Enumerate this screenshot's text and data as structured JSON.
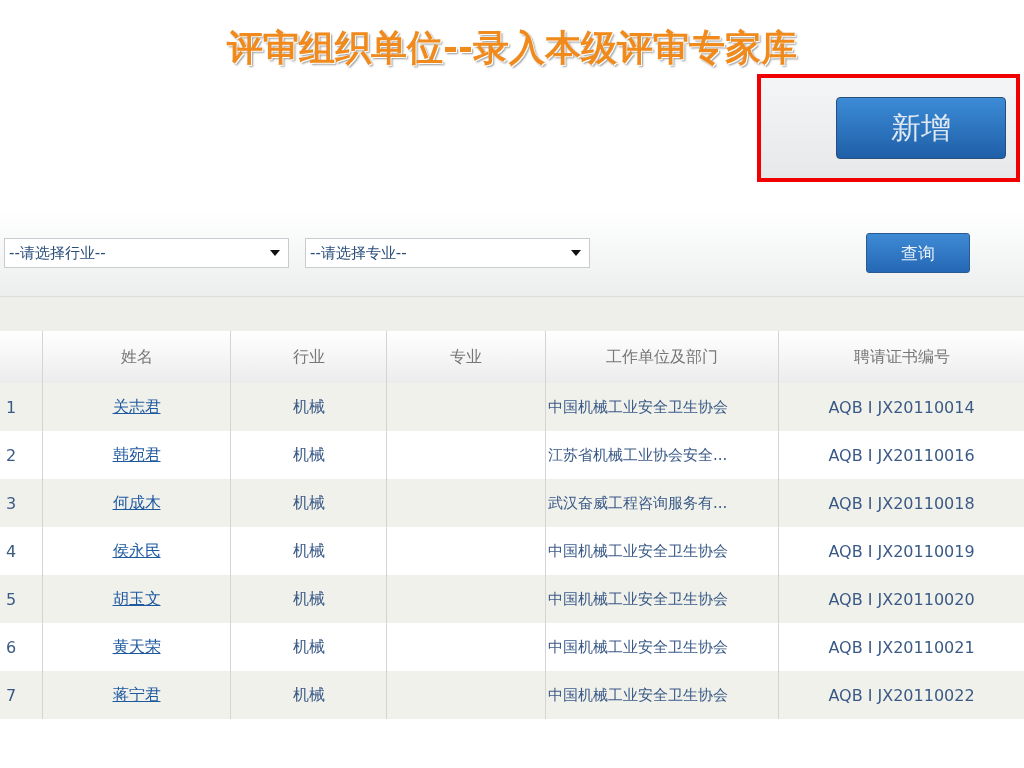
{
  "title": "评审组织单位--录入本级评审专家库",
  "add_button": {
    "label": "新增",
    "highlighted": true
  },
  "filters": [
    {
      "value": "--请选择行业--"
    },
    {
      "value": "--请选择专业--"
    }
  ],
  "query_button": "查询",
  "table": {
    "columns": [
      "",
      "姓名",
      "行业",
      "专业",
      "工作单位及部门",
      "聘请证书编号"
    ],
    "rows": [
      {
        "index": "1",
        "name": "关志君",
        "industry": "机械",
        "work_unit": "中国机械工业安全卫生协会",
        "cert_no": "AQB I JX20110014"
      },
      {
        "index": "2",
        "name": "韩宛君",
        "industry": "机械",
        "work_unit": "江苏省机械工业协会安全...",
        "cert_no": "AQB I JX20110016"
      },
      {
        "index": "3",
        "name": "何成木",
        "industry": "机械",
        "work_unit": "武汉奋威工程咨询服务有...",
        "cert_no": "AQB I JX20110018"
      },
      {
        "index": "4",
        "name": "侯永民",
        "industry": "机械",
        "work_unit": "中国机械工业安全卫生协会",
        "cert_no": "AQB I JX20110019"
      },
      {
        "index": "5",
        "name": "胡玉文",
        "industry": "机械",
        "work_unit": "中国机械工业安全卫生协会",
        "cert_no": "AQB I JX20110020"
      },
      {
        "index": "6",
        "name": "黄天荣",
        "industry": "机械",
        "work_unit": "中国机械工业安全卫生协会",
        "cert_no": "AQB I JX20110021"
      },
      {
        "index": "7",
        "name": "蒋宁君",
        "industry": "机械",
        "work_unit": "中国机械工业安全卫生协会",
        "cert_no": "AQB I JX20110022"
      }
    ]
  }
}
